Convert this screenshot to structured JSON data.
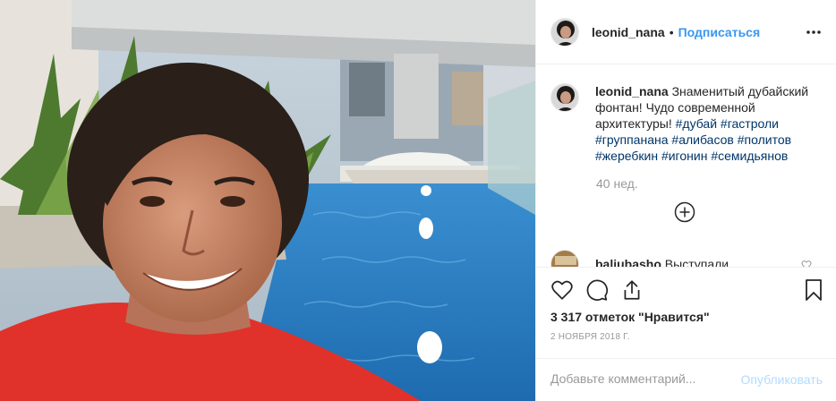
{
  "post": {
    "photo_alt": "Selfie at Dubai fountain pool"
  },
  "header": {
    "username": "leonid_nana",
    "separator": "•",
    "follow_label": "Подписаться",
    "more_icon": "more-horizontal-icon"
  },
  "caption": {
    "username": "leonid_nana",
    "text": "Знаменитый дубайский фонтан! Чудо современной архитектуры!",
    "hashtags": [
      "#дубай",
      "#гастроли",
      "#группанана",
      "#алибасов",
      "#политов",
      "#жеребкин",
      "#игонин",
      "#семидьянов"
    ],
    "time_ago": "40 нед."
  },
  "load_more_icon": "plus-circle-icon",
  "reply": {
    "username": "baliubasho",
    "text": "Выступали"
  },
  "actions": {
    "like_icon": "heart-icon",
    "comment_icon": "comment-icon",
    "share_icon": "share-icon",
    "save_icon": "bookmark-icon",
    "likes_text": "3 317 отметок \"Нравится\"",
    "date": "2 НОЯБРЯ 2018 Г."
  },
  "comment_box": {
    "placeholder": "Добавьте комментарий...",
    "publish_label": "Опубликовать"
  },
  "colors": {
    "link": "#3897f0",
    "hashtag": "#003569",
    "muted": "#999999",
    "publish_disabled": "#b3dbff",
    "border": "#efefef"
  }
}
